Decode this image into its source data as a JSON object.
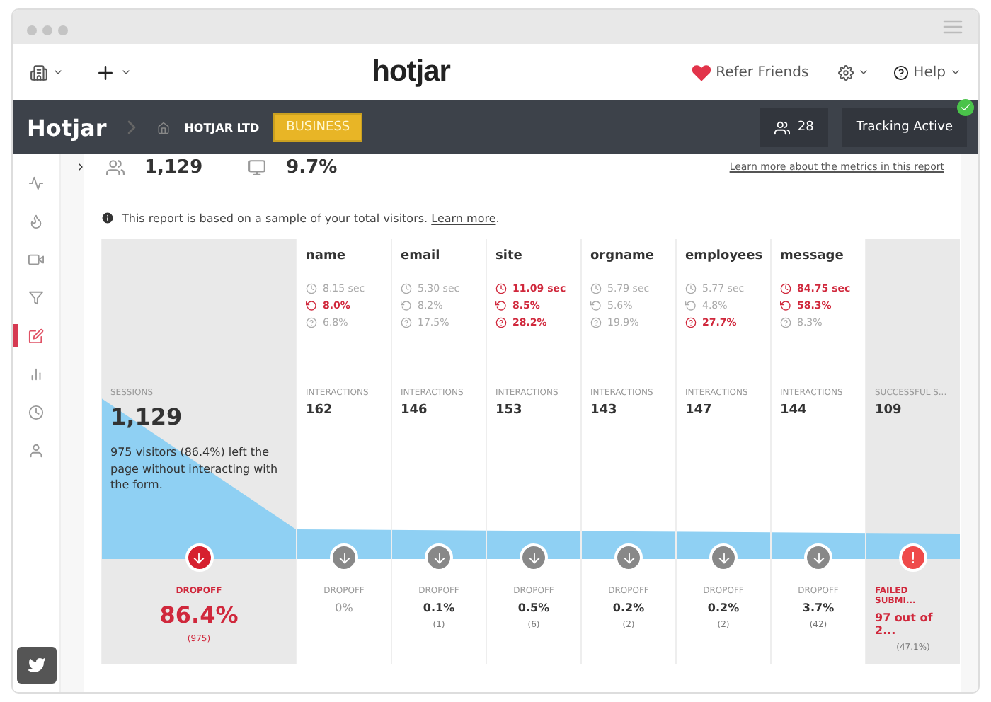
{
  "header": {
    "logo": "hotjar",
    "refer": "Refer Friends",
    "help": "Help"
  },
  "account_bar": {
    "brand": "Hotjar",
    "site": "HOTJAR LTD",
    "plan": "BUSINESS",
    "users": "28",
    "tracking": "Tracking Active",
    "tracking_on": true
  },
  "sidebar": {
    "items": [
      {
        "selected": false
      },
      {
        "selected": false
      },
      {
        "selected": false
      },
      {
        "selected": false
      },
      {
        "selected": true
      },
      {
        "selected": false
      },
      {
        "selected": false
      },
      {
        "selected": false
      }
    ]
  },
  "summary": {
    "sessions": "1,129",
    "rate": "9.7%",
    "link": "Learn more about the metrics in this report"
  },
  "notice": {
    "text": "This report is based on a sample of your total visitors.",
    "link": "Learn more",
    "end": "."
  },
  "sessions": {
    "label": "SESSIONS",
    "value": "1,129",
    "description": "975 visitors (86.4%) left the page without interacting with the form.",
    "dropoff_label": "DROPOFF",
    "dropoff": "86.4%",
    "dropoff_count": "(975)"
  },
  "fields": [
    {
      "name": "name",
      "time": {
        "text": "8.15 sec",
        "alert": false
      },
      "refill": {
        "text": "8.0%",
        "alert": true
      },
      "blank": {
        "text": "6.8%",
        "alert": false
      },
      "interactions_label": "INTERACTIONS",
      "interactions": "162",
      "dropoff_label": "DROPOFF",
      "dropoff": "0%"
    },
    {
      "name": "email",
      "time": {
        "text": "5.30 sec",
        "alert": false
      },
      "refill": {
        "text": "8.2%",
        "alert": false
      },
      "blank": {
        "text": "17.5%",
        "alert": false
      },
      "interactions_label": "INTERACTIONS",
      "interactions": "146",
      "dropoff_label": "DROPOFF",
      "dropoff": "0.1%",
      "count": "(1)"
    },
    {
      "name": "site",
      "time": {
        "text": "11.09 sec",
        "alert": true
      },
      "refill": {
        "text": "8.5%",
        "alert": true
      },
      "blank": {
        "text": "28.2%",
        "alert": true
      },
      "interactions_label": "INTERACTIONS",
      "interactions": "153",
      "dropoff_label": "DROPOFF",
      "dropoff": "0.5%",
      "count": "(6)"
    },
    {
      "name": "orgname",
      "time": {
        "text": "5.79 sec",
        "alert": false
      },
      "refill": {
        "text": "5.6%",
        "alert": false
      },
      "blank": {
        "text": "19.9%",
        "alert": false
      },
      "interactions_label": "INTERACTIONS",
      "interactions": "143",
      "dropoff_label": "DROPOFF",
      "dropoff": "0.2%",
      "count": "(2)"
    },
    {
      "name": "employees",
      "time": {
        "text": "5.77 sec",
        "alert": false
      },
      "refill": {
        "text": "4.8%",
        "alert": false
      },
      "blank": {
        "text": "27.7%",
        "alert": true
      },
      "interactions_label": "INTERACTIONS",
      "interactions": "147",
      "dropoff_label": "DROPOFF",
      "dropoff": "0.2%",
      "count": "(2)"
    },
    {
      "name": "message",
      "time": {
        "text": "84.75 sec",
        "alert": true
      },
      "refill": {
        "text": "58.3%",
        "alert": true
      },
      "blank": {
        "text": "8.3%",
        "alert": false
      },
      "interactions_label": "INTERACTIONS",
      "interactions": "144",
      "dropoff_label": "DROPOFF",
      "dropoff": "3.7%",
      "count": "(42)"
    }
  ],
  "submissions": {
    "label": "SUCCESSFUL S...",
    "value": "109",
    "alert_mark": "!",
    "failed_label": "FAILED SUBMI...",
    "failed": "97 out of 2...",
    "failed_share": "(47.1%)"
  }
}
